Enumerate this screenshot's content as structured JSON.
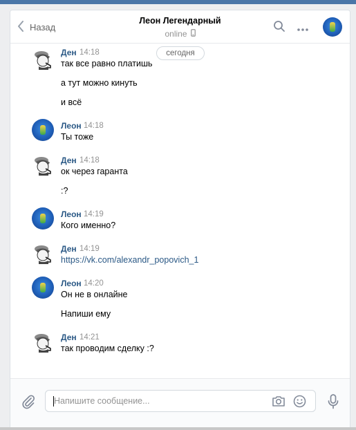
{
  "header": {
    "back_label": "Назад",
    "peer_name": "Леон Легендарный",
    "peer_status": "online"
  },
  "date_divider": "сегодня",
  "messages": [
    {
      "author": "Ден",
      "time": "14:18",
      "lines": [
        "так все равно платишь",
        "а тут можно кинуть",
        "и всё"
      ]
    },
    {
      "author": "Леон",
      "time": "14:18",
      "lines": [
        "Ты тоже"
      ]
    },
    {
      "author": "Ден",
      "time": "14:18",
      "lines": [
        "ок через гаранта",
        ":?"
      ]
    },
    {
      "author": "Леон",
      "time": "14:19",
      "lines": [
        "Кого именно?"
      ]
    },
    {
      "author": "Ден",
      "time": "14:19",
      "lines": [
        "https://vk.com/alexandr_popovich_1"
      ]
    },
    {
      "author": "Леон",
      "time": "14:20",
      "lines": [
        "Он не в онлайне",
        "Напиши ему"
      ]
    },
    {
      "author": "Ден",
      "time": "14:21",
      "lines": [
        "так проводим сделку :?"
      ]
    }
  ],
  "composer": {
    "placeholder": "Напишите сообщение...",
    "value": ""
  },
  "icons": {
    "back": "chevron-left-icon",
    "search": "search-icon",
    "more": "more-dots-icon",
    "mobile": "mobile-phone-icon",
    "attach": "paperclip-icon",
    "camera": "camera-icon",
    "emoji": "smile-icon",
    "mic": "microphone-icon"
  },
  "colors": {
    "accent": "#2a5885",
    "topbar": "#4a76a8",
    "muted": "#939393",
    "background": "#edeef0"
  }
}
